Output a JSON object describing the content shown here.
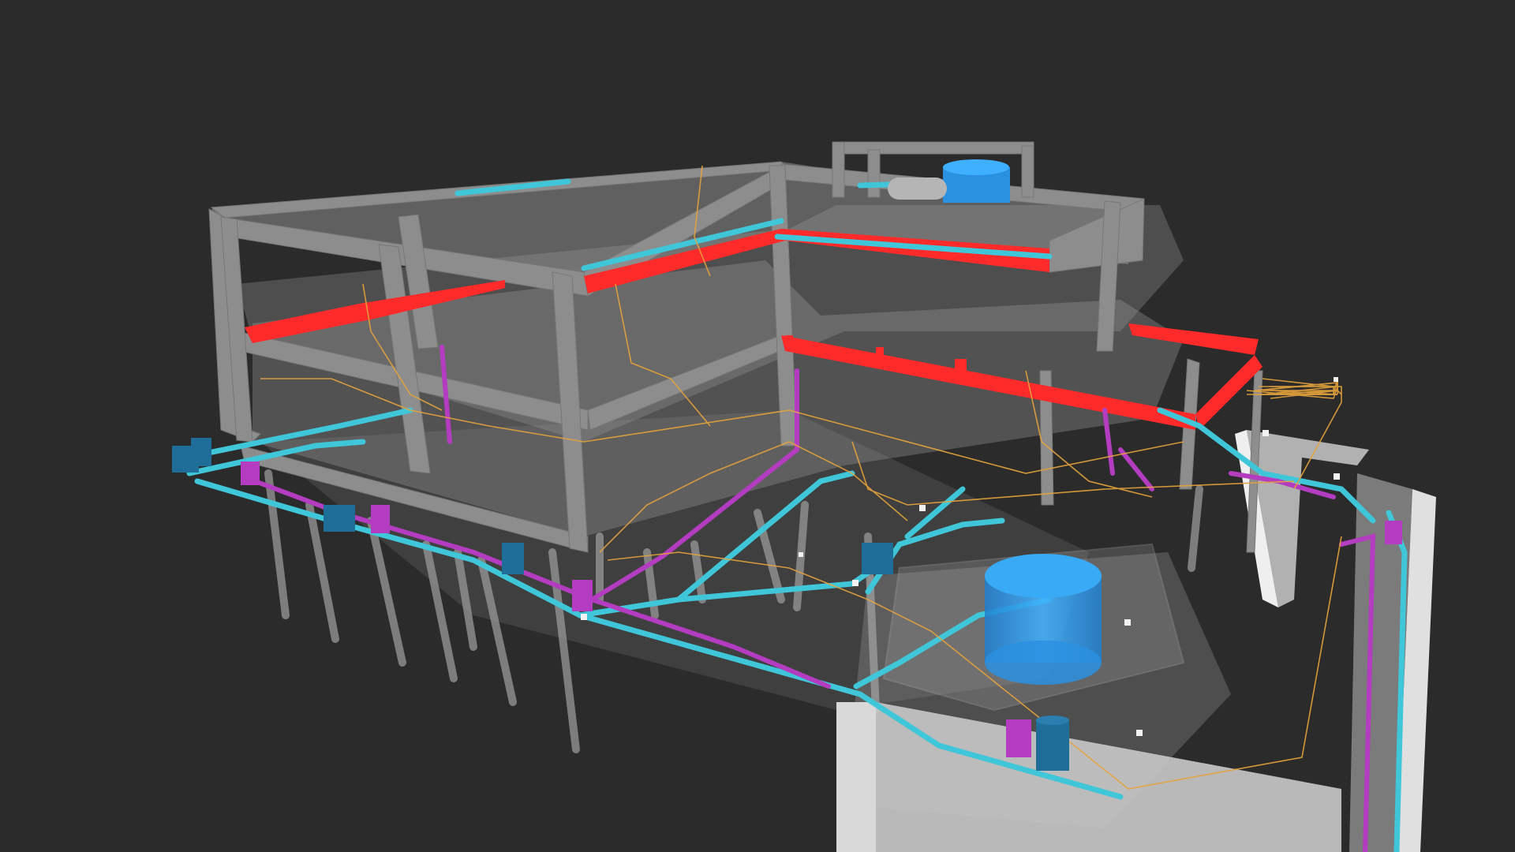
{
  "viewer": {
    "background": "#2b2b2b"
  },
  "palette": {
    "structure": "#8f8f8f",
    "structure_light": "#a4a4a4",
    "structure_dark": "#6a6a6a",
    "fire_protection": "#ff2a2a",
    "cold_water": "#3fc6d8",
    "drainage": "#b43cc0",
    "electrical": "#e6a33c",
    "tank": "#27a1f2",
    "equipment": "#1f6e9a",
    "slab_glass": "#bfbfbf"
  },
  "layers": [
    {
      "name": "structure",
      "icon": "beam-icon"
    },
    {
      "name": "fire-protection",
      "icon": "pipe-icon"
    },
    {
      "name": "cold-water",
      "icon": "pipe-icon"
    },
    {
      "name": "drainage",
      "icon": "pipe-icon"
    },
    {
      "name": "electrical",
      "icon": "cable-icon"
    },
    {
      "name": "tanks",
      "icon": "tank-icon"
    }
  ]
}
